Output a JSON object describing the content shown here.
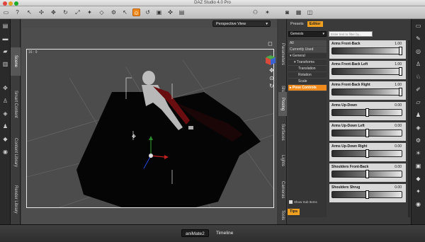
{
  "window": {
    "title": "DAZ Studio 4.0 Pro"
  },
  "toolbar": {
    "active_tool": "rotate-tool",
    "icons": [
      "new-scene-icon",
      "help-icon",
      "pointer-icon",
      "universal-tool-icon",
      "translate-icon",
      "rotate-icon",
      "scale-icon",
      "camera-icon",
      "render-icon"
    ]
  },
  "left_tabs": [
    "Scene",
    "Smart Content",
    "Content Library",
    "Render Library"
  ],
  "viewport": {
    "camera": "Perspective View",
    "aspect_ratio": "16 : 9"
  },
  "bottom_tabs": [
    "aniMate2",
    "Timeline"
  ],
  "right_tabs": [
    "Parameters",
    "Shaping",
    "Posing",
    "Surfaces",
    "Lights",
    "Cameras",
    "Tools"
  ],
  "posing_panel": {
    "tabs": [
      "Presets",
      "Editor"
    ],
    "figure_select": "Genesis",
    "filter_placeholder": "Enter text to filter by...",
    "tree": [
      {
        "label": "All",
        "level": 0,
        "selected": false
      },
      {
        "label": "Currently Used",
        "level": 0,
        "selected": false
      },
      {
        "label": "▾ General",
        "level": 0,
        "selected": false
      },
      {
        "label": "▾ Transforms",
        "level": 1,
        "selected": false
      },
      {
        "label": "Translation",
        "level": 2,
        "selected": false
      },
      {
        "label": "Rotation",
        "level": 2,
        "selected": false
      },
      {
        "label": "Scale",
        "level": 2,
        "selected": false
      },
      {
        "label": "▸ Pose Controls",
        "level": 0,
        "selected": true
      }
    ],
    "show_sub_items": "Show Sub Items",
    "sliders": [
      {
        "label": "Arms Front-Back",
        "value": "1.00",
        "position": 1.0
      },
      {
        "label": "Arms Front-Back Left",
        "value": "1.00",
        "position": 1.0
      },
      {
        "label": "Arms Front-Back Right",
        "value": "1.00",
        "position": 1.0
      },
      {
        "label": "Arms Up-Down",
        "value": "0.00",
        "position": 0.5
      },
      {
        "label": "Arms Up-Down Left",
        "value": "0.00",
        "position": 0.5
      },
      {
        "label": "Arms Up-Down Right",
        "value": "0.00",
        "position": 0.5
      },
      {
        "label": "Shoulders Front-Back",
        "value": "0.00",
        "position": 0.5
      },
      {
        "label": "Shoulders Shrug",
        "value": "0.00",
        "position": 0.5
      }
    ],
    "tips_label": "Tips"
  },
  "colors": {
    "accent": "#f08a1c",
    "editor_tab": "#f0a020"
  }
}
